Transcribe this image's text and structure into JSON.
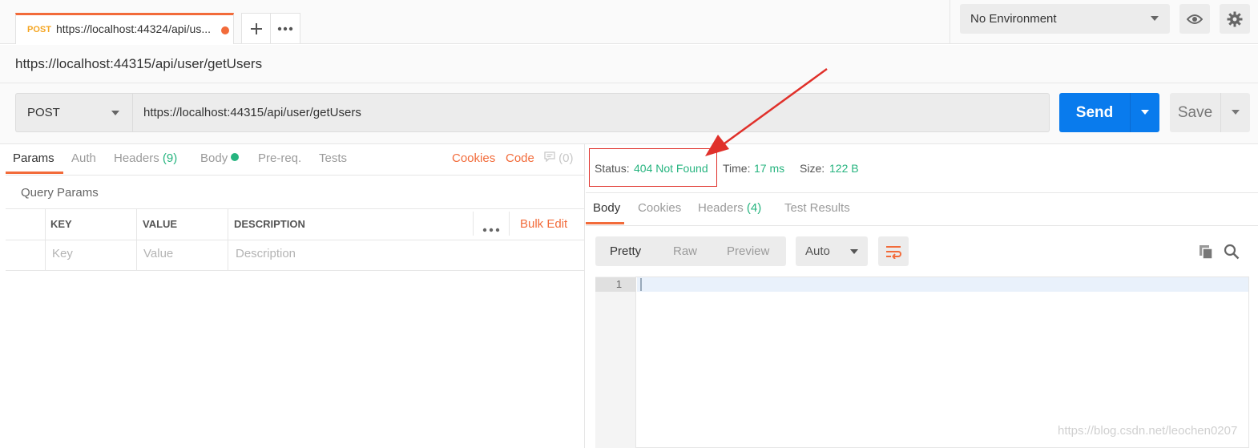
{
  "tab": {
    "method": "POST",
    "title": "https://localhost:44324/api/us..."
  },
  "environment": {
    "selected": "No Environment"
  },
  "request": {
    "name": "https://localhost:44315/api/user/getUsers",
    "method": "POST",
    "url": "https://localhost:44315/api/user/getUsers",
    "send_label": "Send",
    "save_label": "Save"
  },
  "request_tabs": {
    "params": "Params",
    "auth": "Auth",
    "headers": "Headers",
    "headers_count": "(9)",
    "body": "Body",
    "prereq": "Pre-req.",
    "tests": "Tests",
    "cookies": "Cookies",
    "code": "Code",
    "comments_count": "(0)"
  },
  "query_params": {
    "title": "Query Params",
    "columns": [
      "KEY",
      "VALUE",
      "DESCRIPTION"
    ],
    "bulk_edit": "Bulk Edit",
    "placeholders": {
      "key": "Key",
      "value": "Value",
      "description": "Description"
    }
  },
  "response": {
    "status_label": "Status:",
    "status_value": "404 Not Found",
    "time_label": "Time:",
    "time_value": "17 ms",
    "size_label": "Size:",
    "size_value": "122 B",
    "tabs": {
      "body": "Body",
      "cookies": "Cookies",
      "headers": "Headers",
      "headers_count": "(4)",
      "test_results": "Test Results"
    },
    "formats": [
      "Pretty",
      "Raw",
      "Preview"
    ],
    "language": "Auto",
    "line_number": "1"
  },
  "watermark": "https://blog.csdn.net/leochen0207",
  "colors": {
    "accent": "#f26b3a",
    "send": "#097bed",
    "success": "#26b47f",
    "annotation": "#e0302a"
  },
  "icons": [
    "plus-icon",
    "more-icon",
    "eye-icon",
    "gear-icon",
    "comment-icon",
    "wrap-icon",
    "copy-icon",
    "search-icon"
  ]
}
